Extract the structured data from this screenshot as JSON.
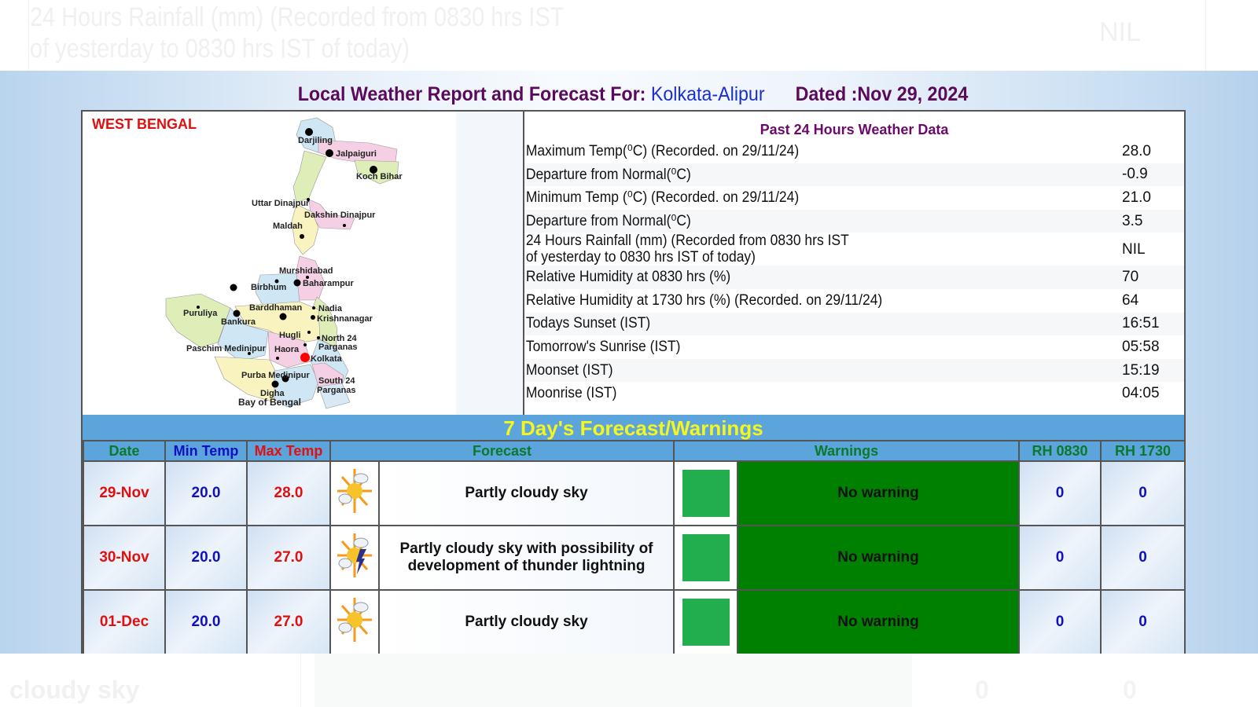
{
  "background_fade": {
    "top_label": "24 Hours Rainfall (mm) (Recorded from 0830 hrs IST",
    "top_label2": "of yesterday to 0830 hrs IST of today)",
    "top_value": "NIL",
    "bottom_label": "cloudy sky",
    "bottom_rh1": "0",
    "bottom_rh2": "0"
  },
  "header": {
    "prefix": "Local Weather Report and Forecast For:",
    "station": "Kolkata-Alipur",
    "dated": "Dated :Nov 29, 2024"
  },
  "map": {
    "state_title": "WEST BENGAL",
    "labels": [
      "Darjiling",
      "Jalpaiguri",
      "Koch Bihar",
      "Uttar Dinajpur",
      "Dakshin Dinajpur",
      "Maldah",
      "Murshidabad",
      "Baharampur",
      "Birbhum",
      "Barddhaman",
      "Nadia",
      "Krishnanagar",
      "Puruliya",
      "Bankura",
      "Hugli",
      "North 24",
      "Parganas",
      "Paschim Medinipur",
      "Haora",
      "Kolkata",
      "Purba Medinipur",
      "South 24",
      "Parganas",
      "Digha",
      "Bay of Bengal"
    ],
    "colors": {
      "highlight": "#ff0000"
    }
  },
  "past24": {
    "heading": "Past 24 Hours Weather Data",
    "rows": [
      {
        "label": "Maximum Temp(⁰C) (Recorded. on 29/11/24)",
        "value": "28.0"
      },
      {
        "label": "Departure from Normal(⁰C)",
        "value": "-0.9"
      },
      {
        "label": "Minimum Temp (⁰C) (Recorded. on 29/11/24)",
        "value": "21.0"
      },
      {
        "label": "Departure from Normal(⁰C)",
        "value": "3.5"
      },
      {
        "label": "24 Hours Rainfall (mm) (Recorded from 0830 hrs IST",
        "label2": "of yesterday to 0830 hrs IST of today)",
        "value": "NIL"
      },
      {
        "label": "Relative Humidity at 0830 hrs (%)",
        "value": "70"
      },
      {
        "label": "Relative Humidity at 1730 hrs (%) (Recorded. on 29/11/24)",
        "value": "64"
      },
      {
        "label": "Todays Sunset (IST)",
        "value": "16:51"
      },
      {
        "label": "Tomorrow's Sunrise (IST)",
        "value": "05:58"
      },
      {
        "label": "Moonset (IST)",
        "value": "15:19"
      },
      {
        "label": "Moonrise (IST)",
        "value": "04:05"
      }
    ]
  },
  "forecast": {
    "title": "7 Day's Forecast/Warnings",
    "columns": [
      "Date",
      "Min Temp",
      "Max Temp",
      "Forecast",
      "Warnings",
      "RH 0830",
      "RH 1730"
    ],
    "rows": [
      {
        "date": "29-Nov",
        "min": "20.0",
        "max": "28.0",
        "icon": "partly-cloudy-icon",
        "forecast": "Partly cloudy sky",
        "warning": "No warning",
        "warning_color": "#22ad4e",
        "rh0830": "0",
        "rh1730": "0"
      },
      {
        "date": "30-Nov",
        "min": "20.0",
        "max": "27.0",
        "icon": "thunder-lightning-icon",
        "forecast": "Partly cloudy sky with possibility of development of thunder lightning",
        "warning": "No warning",
        "warning_color": "#22ad4e",
        "rh0830": "0",
        "rh1730": "0"
      },
      {
        "date": "01-Dec",
        "min": "20.0",
        "max": "27.0",
        "icon": "partly-cloudy-icon",
        "forecast": "Partly cloudy sky",
        "warning": "No warning",
        "warning_color": "#22ad4e",
        "rh0830": "0",
        "rh1730": "0"
      }
    ]
  },
  "colors": {
    "band": "#5ca4dc",
    "band_text": "#f5f520",
    "warning_bg": "#008000",
    "title": "#5a0a5a",
    "station": "#1a2fd0"
  }
}
